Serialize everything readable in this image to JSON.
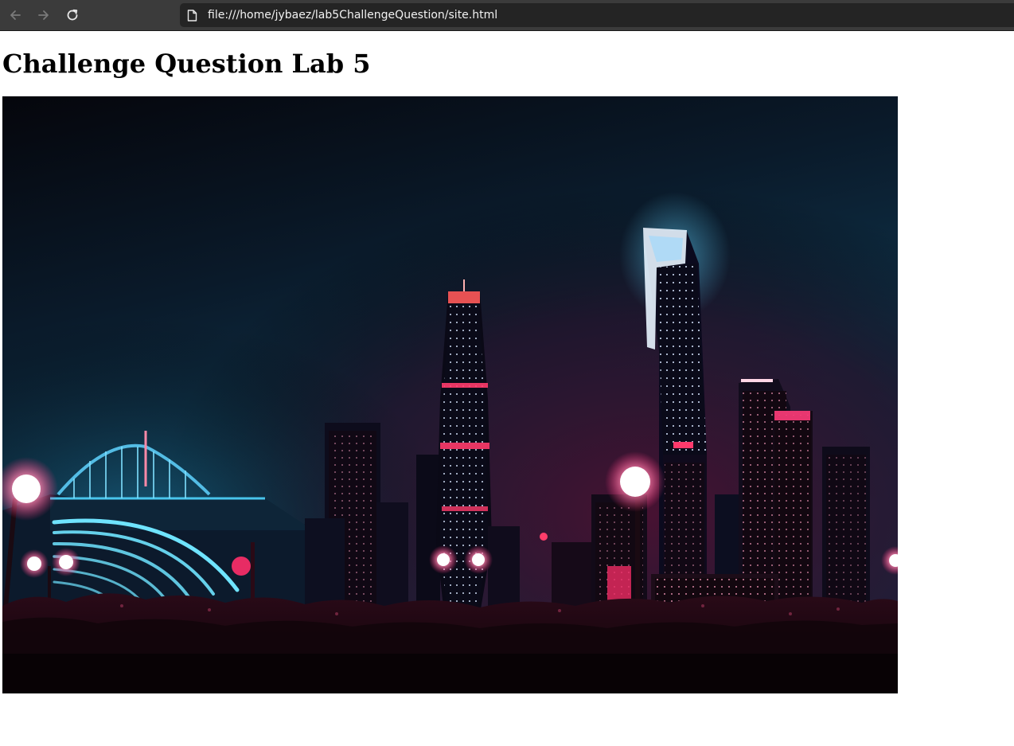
{
  "browser": {
    "url": "file:///home/jybaez/lab5ChallengeQuestion/site.html",
    "icons": {
      "back": "arrow-left-icon",
      "forward": "arrow-right-icon",
      "reload": "reload-icon",
      "page": "page-file-icon"
    }
  },
  "page": {
    "title": "Challenge Question Lab 5"
  },
  "image": {
    "subject": "night city skyline photo",
    "colors": {
      "sky_top": "#05060c",
      "sky_blue": "#0e2f48",
      "sky_magenta": "#3a0f2a",
      "neon_cyan": "#4fd6ff",
      "neon_pink": "#ff3d7f"
    }
  }
}
